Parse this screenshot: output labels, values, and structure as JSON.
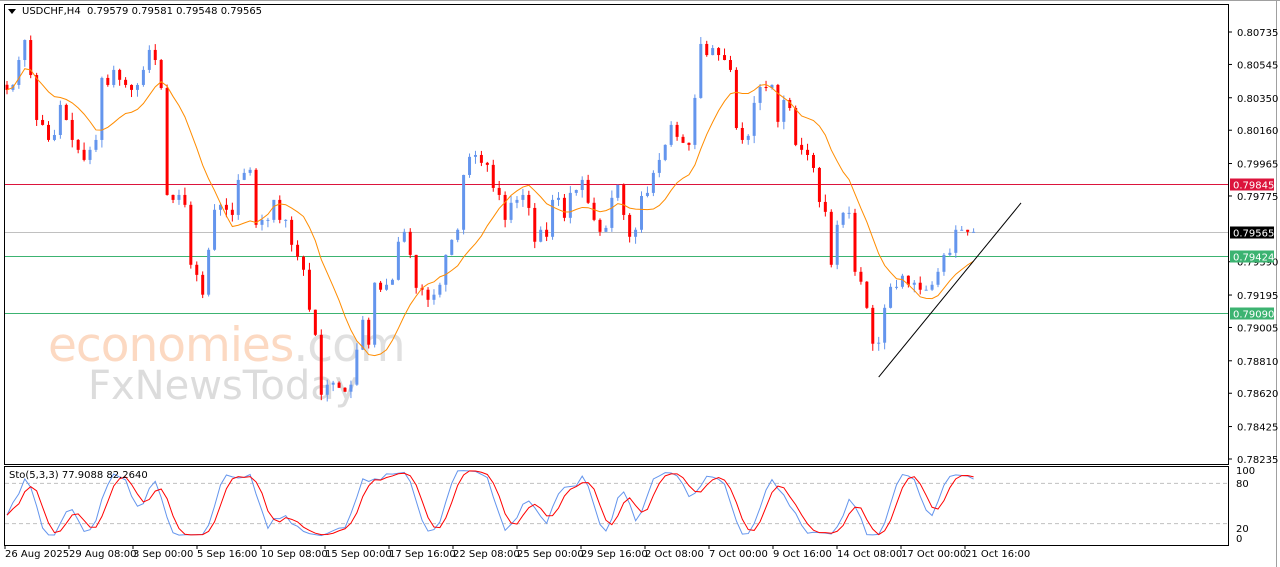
{
  "header": {
    "symbol": "USDCHF,H4",
    "open": "0.79579",
    "high": "0.79581",
    "low": "0.79548",
    "close": "0.79565"
  },
  "indicator": {
    "label": "Sto(5,3,3)",
    "main": "77.9088",
    "signal": "82.2640",
    "levels": [
      "100",
      "80",
      "20",
      "0"
    ]
  },
  "watermark": {
    "line1": "economies",
    "line1_suffix": ".com",
    "line2": "FxNewsToday"
  },
  "colors": {
    "bull": "#6495ed",
    "bear": "#ff0000",
    "ma": "#ff8c00",
    "resistance": "#dc143c",
    "support": "#3cb371",
    "current": "#c0c0c0",
    "trend": "#000000"
  },
  "chart_data": {
    "type": "candlestick",
    "title": "USDCHF,H4",
    "ylim": [
      0.78235,
      0.80735
    ],
    "y_ticks": [
      "0.80735",
      "0.80545",
      "0.80350",
      "0.80160",
      "0.79965",
      "0.79775",
      "0.79390",
      "0.79195",
      "0.79005",
      "0.78810",
      "0.78620",
      "0.78425",
      "0.78235"
    ],
    "x_ticks": [
      "26 Aug 2025",
      "29 Aug 08:00",
      "3 Sep 00:00",
      "5 Sep 16:00",
      "10 Sep 08:00",
      "15 Sep 00:00",
      "17 Sep 16:00",
      "22 Sep 08:00",
      "25 Sep 00:00",
      "29 Sep 16:00",
      "2 Oct 08:00",
      "7 Oct 00:00",
      "9 Oct 16:00",
      "14 Oct 08:00",
      "17 Oct 00:00",
      "21 Oct 16:00"
    ],
    "closes": [
      0.80396,
      0.80425,
      0.80571,
      0.80688,
      0.80483,
      0.8022,
      0.80191,
      0.80103,
      0.80132,
      0.80308,
      0.8022,
      0.80103,
      0.80045,
      0.79986,
      0.80045,
      0.80103,
      0.80466,
      0.80425,
      0.80513,
      0.80455,
      0.80425,
      0.80396,
      0.80425,
      0.80513,
      0.8063,
      0.80571,
      0.80407,
      0.79781,
      0.79752,
      0.79781,
      0.79723,
      0.79372,
      0.79313,
      0.79197,
      0.7946,
      0.79694,
      0.79723,
      0.79694,
      0.79664,
      0.79869,
      0.7991,
      0.79928,
      0.79606,
      0.79635,
      0.79635,
      0.79752,
      0.79635,
      0.79635,
      0.79489,
      0.79419,
      0.79343,
      0.79109,
      0.78962,
      0.78611,
      0.7867,
      0.78682,
      0.78652,
      0.78629,
      0.7867,
      0.78875,
      0.7905,
      0.78904,
      0.79267,
      0.79226,
      0.79255,
      0.79284,
      0.79507,
      0.79565,
      0.7943,
      0.79237,
      0.79226,
      0.79167,
      0.79197,
      0.79255,
      0.7943,
      0.79518,
      0.79577,
      0.79898,
      0.80004,
      0.80015,
      0.79969,
      0.79957,
      0.79822,
      0.79781,
      0.79635,
      0.79735,
      0.79752,
      0.79781,
      0.79705,
      0.79507,
      0.79577,
      0.79536,
      0.79752,
      0.79764,
      0.79647,
      0.79793,
      0.7981,
      0.79869,
      0.79735,
      0.79635,
      0.79565,
      0.79588,
      0.79764,
      0.7984,
      0.79664,
      0.79536,
      0.79577,
      0.79775,
      0.79793,
      0.7991,
      0.79986,
      0.80074,
      0.80191,
      0.80121,
      0.80086,
      0.80074,
      0.80349,
      0.80665,
      0.806,
      0.80641,
      0.806,
      0.80571,
      0.80513,
      0.80173,
      0.80103,
      0.80127,
      0.8032,
      0.80413,
      0.80407,
      0.80425,
      0.80209,
      0.80337,
      0.8029,
      0.80074,
      0.80045,
      0.80015,
      0.79939,
      0.7974,
      0.79682,
      0.79372,
      0.79606,
      0.79676,
      0.79676,
      0.79331,
      0.79273,
      0.7912,
      0.7891,
      0.78916,
      0.7912,
      0.79243,
      0.79243,
      0.79308,
      0.79255,
      0.79267,
      0.79226,
      0.79226,
      0.79255,
      0.79331,
      0.7943,
      0.79442,
      0.79577,
      0.79577,
      0.79565,
      0.79565
    ],
    "ma_period": 12,
    "hlines": [
      {
        "price": "0.79845",
        "role": "resistance"
      },
      {
        "price": "0.79565",
        "role": "current"
      },
      {
        "price": "0.79424",
        "role": "support"
      },
      {
        "price": "0.79090",
        "role": "support"
      }
    ],
    "trendline": {
      "from_index": 147,
      "from_price": 0.78715,
      "to_index": 171,
      "to_price": 0.79734
    }
  }
}
